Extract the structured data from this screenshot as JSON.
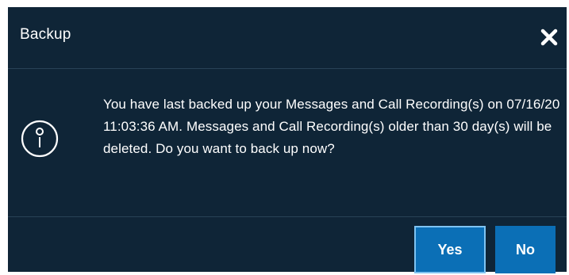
{
  "dialog": {
    "title": "Backup",
    "close_icon": "close-icon",
    "info_icon": "info-icon",
    "message": "You have last backed up your Messages and Call Recording(s) on 07/16/20 11:03:36 AM. Messages and Call Recording(s) older than 30 day(s) will be deleted. Do you want to back up now?",
    "buttons": {
      "yes": "Yes",
      "no": "No"
    },
    "colors": {
      "background": "#0f2537",
      "button": "#0b6fb6",
      "focus_border": "#7fc4f2",
      "divider": "#284256"
    }
  }
}
